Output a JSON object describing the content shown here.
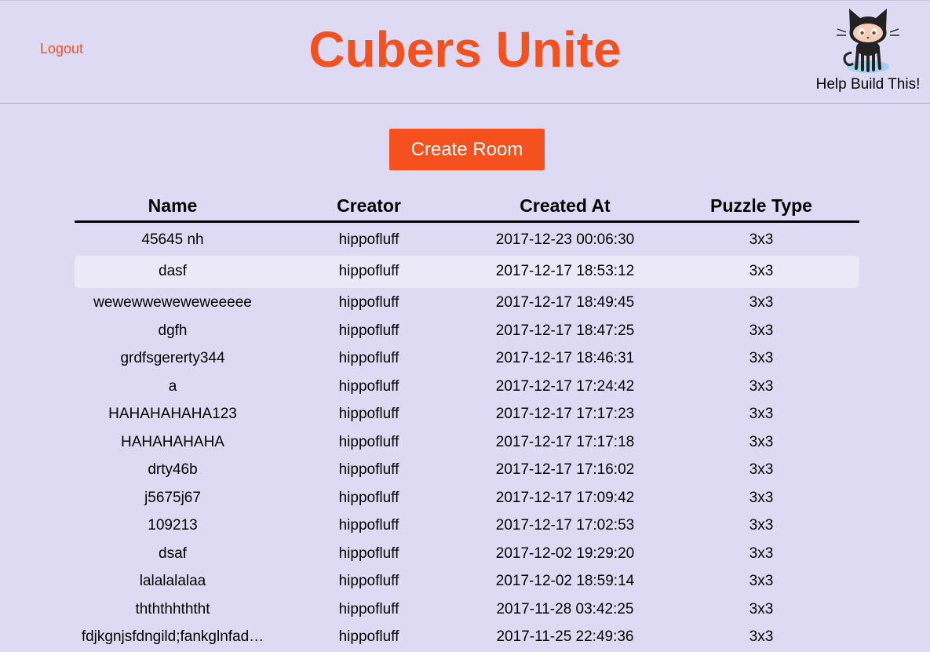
{
  "header": {
    "logout_label": "Logout",
    "title": "Cubers Unite",
    "help_label": "Help Build This!",
    "brand_color": "#f4511e",
    "help_icon": "octocat-icon"
  },
  "actions": {
    "create_room_label": "Create Room"
  },
  "table": {
    "columns": [
      "Name",
      "Creator",
      "Created At",
      "Puzzle Type"
    ],
    "rows": [
      {
        "name": "45645 nh",
        "creator": "hippofluff",
        "created_at": "2017-12-23 00:06:30",
        "puzzle_type": "3x3"
      },
      {
        "name": "dasf",
        "creator": "hippofluff",
        "created_at": "2017-12-17 18:53:12",
        "puzzle_type": "3x3"
      },
      {
        "name": "wewewwewewewee­eee",
        "creator": "hippofluff",
        "created_at": "2017-12-17 18:49:45",
        "puzzle_type": "3x3"
      },
      {
        "name": "dgfh",
        "creator": "hippofluff",
        "created_at": "2017-12-17 18:47:25",
        "puzzle_type": "3x3"
      },
      {
        "name": "grdfsgererty344",
        "creator": "hippofluff",
        "created_at": "2017-12-17 18:46:31",
        "puzzle_type": "3x3"
      },
      {
        "name": "a",
        "creator": "hippofluff",
        "created_at": "2017-12-17 17:24:42",
        "puzzle_type": "3x3"
      },
      {
        "name": "HAHAHAHAHA123",
        "creator": "hippofluff",
        "created_at": "2017-12-17 17:17:23",
        "puzzle_type": "3x3"
      },
      {
        "name": "HAHAHAHAHA",
        "creator": "hippofluff",
        "created_at": "2017-12-17 17:17:18",
        "puzzle_type": "3x3"
      },
      {
        "name": "drty46b",
        "creator": "hippofluff",
        "created_at": "2017-12-17 17:16:02",
        "puzzle_type": "3x3"
      },
      {
        "name": "j5675j67",
        "creator": "hippofluff",
        "created_at": "2017-12-17 17:09:42",
        "puzzle_type": "3x3"
      },
      {
        "name": "109213",
        "creator": "hippofluff",
        "created_at": "2017-12-17 17:02:53",
        "puzzle_type": "3x3"
      },
      {
        "name": "dsaf",
        "creator": "hippofluff",
        "created_at": "2017-12-02 19:29:20",
        "puzzle_type": "3x3"
      },
      {
        "name": "lalalalalaa",
        "creator": "hippofluff",
        "created_at": "2017-12-02 18:59:14",
        "puzzle_type": "3x3"
      },
      {
        "name": "thththhththt",
        "creator": "hippofluff",
        "created_at": "2017-11-28 03:42:25",
        "puzzle_type": "3x3"
      },
      {
        "name": "fdjkgnjsfdngild;fankglnfad…",
        "creator": "hippofluff",
        "created_at": "2017-11-25 22:49:36",
        "puzzle_type": "3x3"
      }
    ]
  }
}
